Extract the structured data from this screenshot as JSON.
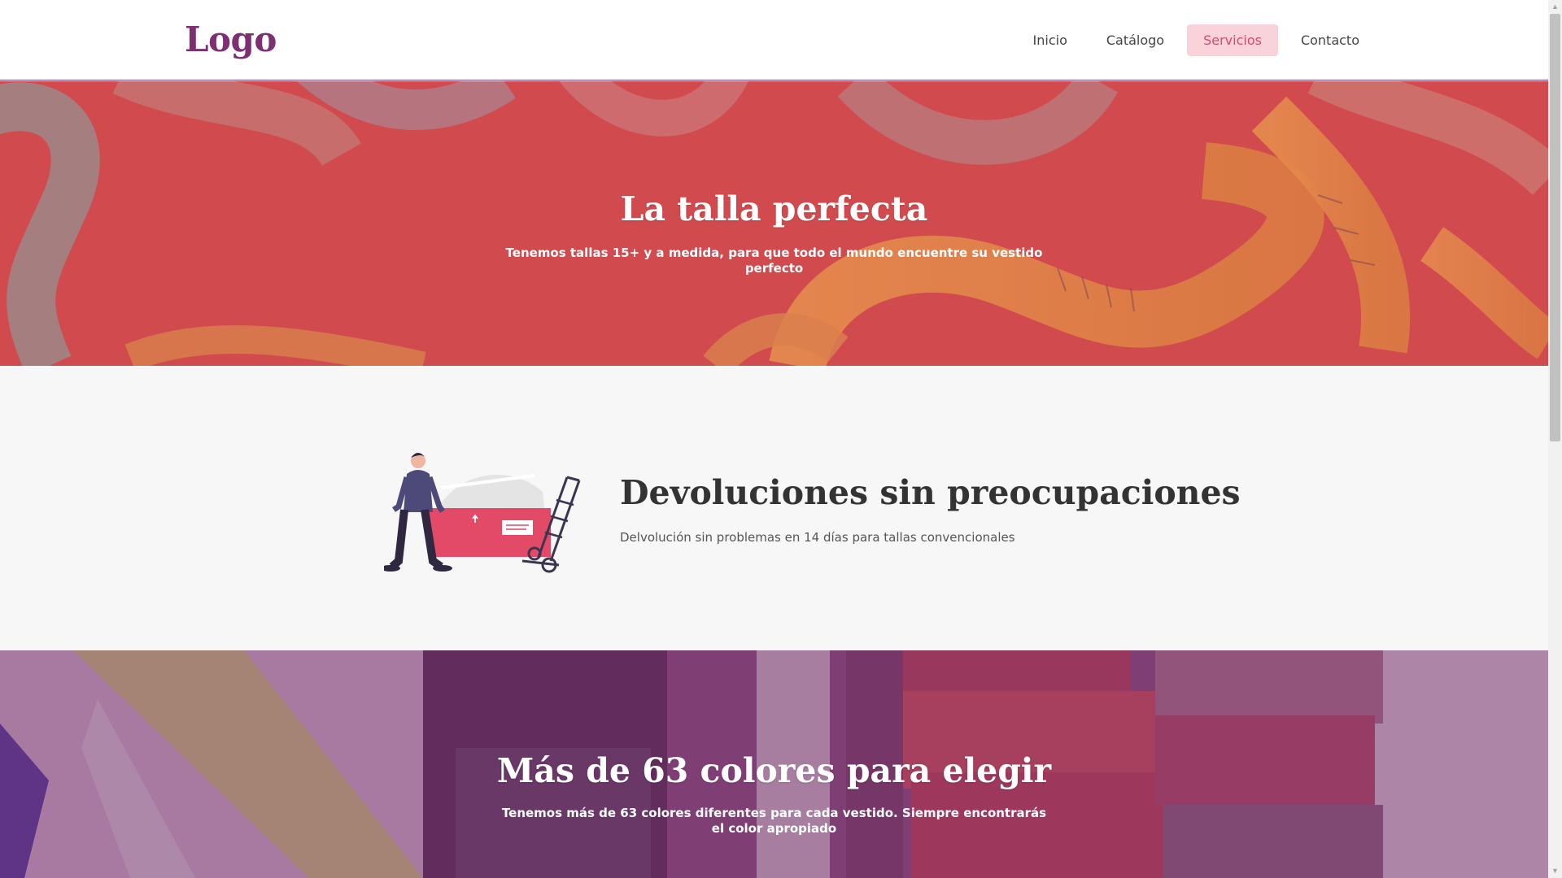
{
  "header": {
    "logo": "Logo",
    "nav": [
      {
        "label": "Inicio",
        "active": false
      },
      {
        "label": "Catálogo",
        "active": false
      },
      {
        "label": "Servicios",
        "active": true
      },
      {
        "label": "Contacto",
        "active": false
      }
    ]
  },
  "hero_sizes": {
    "title": "La talla perfecta",
    "subtitle": "Tenemos tallas 15+ y a medida, para que todo el mundo encuentre su vestido perfecto"
  },
  "feature_returns": {
    "title": "Devoluciones sin preocupaciones",
    "text": "Delvolución sin problemas en 14 días para tallas convencionales"
  },
  "hero_colors": {
    "title": "Más de 63 colores para elegir",
    "subtitle": "Tenemos más de 63 colores diferentes para cada vestido. Siempre encontrarás el color apropiado"
  },
  "colors": {
    "brand": "#7d2f72",
    "nav_active_bg": "#f9d3dc",
    "nav_active_text": "#d44a6a",
    "hero1_tint": "#cf4f4c",
    "hero2_tint": "#7a3a73"
  }
}
